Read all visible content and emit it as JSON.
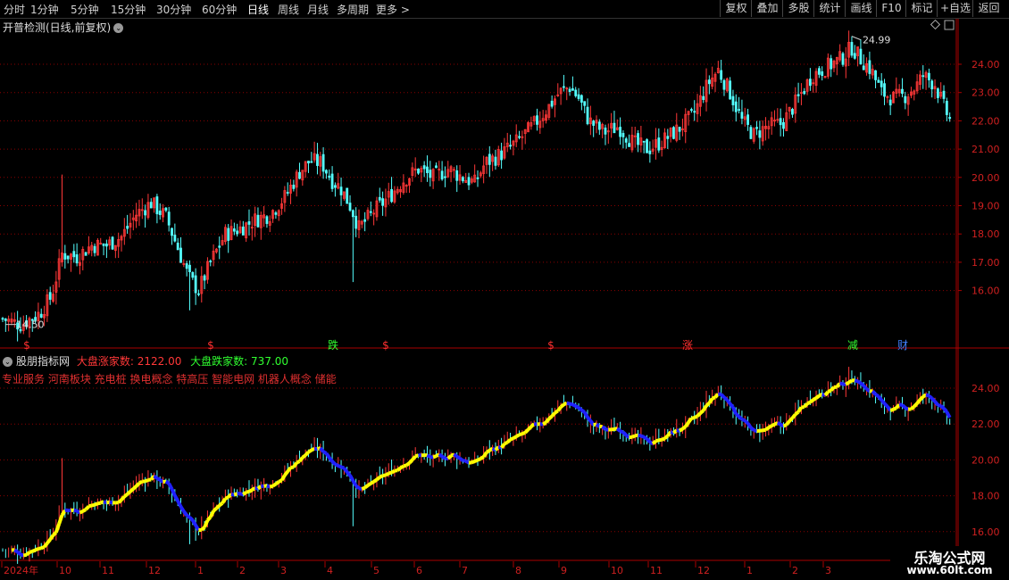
{
  "toolbar": {
    "periods": [
      "分时",
      "1分钟",
      "5分钟",
      "15分钟",
      "30分钟",
      "60分钟",
      "日线",
      "周线",
      "月线",
      "多周期",
      "更多 >"
    ],
    "active_period": "日线",
    "right_buttons": [
      "复权",
      "叠加",
      "多股",
      "统计",
      "画线",
      "F10",
      "标记",
      "+自选",
      "返回"
    ]
  },
  "main_chart": {
    "title": "开普检测(日线,前复权)",
    "high_label": "24.99",
    "low_label": "14.50",
    "y_ticks": [
      "24.00",
      "23.00",
      "22.00",
      "21.00",
      "20.00",
      "19.00",
      "18.00",
      "17.00",
      "16.00"
    ],
    "event_marks": [
      {
        "text": "$",
        "color": "#ff3030"
      },
      {
        "text": "$",
        "color": "#ff3030"
      },
      {
        "text": "跌",
        "color": "#30ff30"
      },
      {
        "text": "$",
        "color": "#ff3030"
      },
      {
        "text": "$",
        "color": "#ff3030"
      },
      {
        "text": "涨",
        "color": "#ff3030"
      },
      {
        "text": "减",
        "color": "#30ff30"
      },
      {
        "text": "财",
        "color": "#4080ff"
      }
    ]
  },
  "indicator": {
    "name": "股朋指标网",
    "up_label": "大盘涨家数:",
    "up_value": "2122.00",
    "down_label": "大盘跌家数:",
    "down_value": "737.00",
    "concepts": "专业服务 河南板块 充电桩 换电概念 特高压 智能电网 机器人概念 储能",
    "y_ticks": [
      "24.00",
      "22.00",
      "20.00",
      "18.00",
      "16.00"
    ]
  },
  "time_axis": {
    "labels": [
      "2024年",
      "10",
      "11",
      "12",
      "1",
      "2",
      "3",
      "4",
      "5",
      "6",
      "7",
      "8",
      "9",
      "10",
      "11",
      "12",
      "1",
      "2",
      "3"
    ]
  },
  "watermark": {
    "line1": "乐淘公式网",
    "line2": "www.60lt.com"
  },
  "colors": {
    "up": "#ff3838",
    "down": "#54ffff",
    "grid": "#8b0000",
    "trend_up": "#ffff00",
    "trend_down": "#2020ff"
  },
  "chart_data": {
    "type": "candlestick",
    "anchors": [
      [
        0,
        15.0
      ],
      [
        12,
        14.8
      ],
      [
        25,
        15.2
      ],
      [
        33,
        15.8
      ],
      [
        40,
        17.3
      ],
      [
        50,
        17.2
      ],
      [
        60,
        17.6
      ],
      [
        70,
        17.6
      ],
      [
        80,
        17.9
      ],
      [
        90,
        18.7
      ],
      [
        100,
        19.1
      ],
      [
        110,
        18.6
      ],
      [
        118,
        17.5
      ],
      [
        125,
        16.5
      ],
      [
        132,
        16.0
      ],
      [
        140,
        17.0
      ],
      [
        150,
        18.0
      ],
      [
        160,
        18.2
      ],
      [
        170,
        18.5
      ],
      [
        180,
        18.7
      ],
      [
        190,
        19.3
      ],
      [
        200,
        20.2
      ],
      [
        207,
        20.6
      ],
      [
        215,
        20.5
      ],
      [
        222,
        19.9
      ],
      [
        228,
        19.6
      ],
      [
        235,
        18.9
      ],
      [
        240,
        18.2
      ],
      [
        250,
        18.8
      ],
      [
        260,
        19.3
      ],
      [
        270,
        19.9
      ],
      [
        280,
        20.3
      ],
      [
        290,
        20.0
      ],
      [
        300,
        20.3
      ],
      [
        310,
        20.0
      ],
      [
        318,
        19.8
      ],
      [
        325,
        20.5
      ],
      [
        335,
        20.8
      ],
      [
        345,
        21.2
      ],
      [
        355,
        21.7
      ],
      [
        365,
        22.3
      ],
      [
        375,
        23.0
      ],
      [
        382,
        23.2
      ],
      [
        388,
        22.8
      ],
      [
        395,
        22.0
      ],
      [
        405,
        21.6
      ],
      [
        415,
        21.8
      ],
      [
        425,
        21.2
      ],
      [
        435,
        21.0
      ],
      [
        445,
        21.3
      ],
      [
        455,
        21.7
      ],
      [
        465,
        22.2
      ],
      [
        475,
        23.3
      ],
      [
        482,
        23.8
      ],
      [
        490,
        23.0
      ],
      [
        498,
        22.0
      ],
      [
        506,
        21.5
      ],
      [
        515,
        21.8
      ],
      [
        525,
        21.9
      ],
      [
        535,
        22.7
      ],
      [
        545,
        23.6
      ],
      [
        555,
        23.9
      ],
      [
        565,
        24.2
      ],
      [
        572,
        24.6
      ],
      [
        578,
        24.2
      ],
      [
        585,
        23.8
      ],
      [
        592,
        23.0
      ],
      [
        600,
        22.8
      ],
      [
        608,
        22.9
      ],
      [
        615,
        23.2
      ],
      [
        620,
        23.6
      ],
      [
        628,
        23.3
      ],
      [
        634,
        22.5
      ],
      [
        640,
        21.8
      ]
    ],
    "price_range": [
      14.5,
      24.99
    ],
    "ylim": [
      14.5,
      24.99
    ]
  }
}
